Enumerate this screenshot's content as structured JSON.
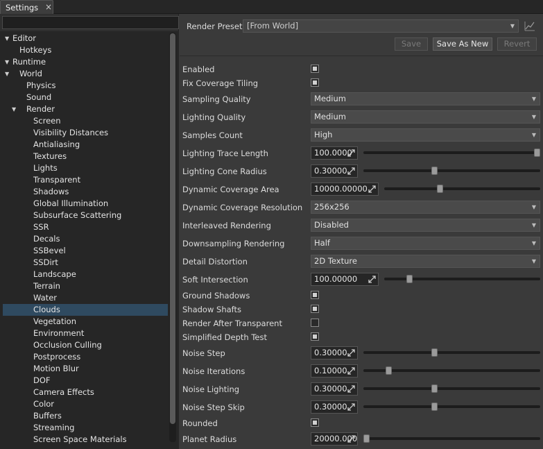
{
  "tab": {
    "label": "Settings",
    "close": "×"
  },
  "search": {
    "value": "",
    "placeholder": ""
  },
  "tree": [
    {
      "label": "Editor",
      "depth": 0,
      "expanded": true
    },
    {
      "label": "Hotkeys",
      "depth": 1
    },
    {
      "label": "Runtime",
      "depth": 0,
      "expanded": true
    },
    {
      "label": "World",
      "depth": 1,
      "expanded": true
    },
    {
      "label": "Physics",
      "depth": 2
    },
    {
      "label": "Sound",
      "depth": 2
    },
    {
      "label": "Render",
      "depth": 2,
      "expanded": true
    },
    {
      "label": "Screen",
      "depth": 3
    },
    {
      "label": "Visibility Distances",
      "depth": 3
    },
    {
      "label": "Antialiasing",
      "depth": 3
    },
    {
      "label": "Textures",
      "depth": 3
    },
    {
      "label": "Lights",
      "depth": 3
    },
    {
      "label": "Transparent",
      "depth": 3
    },
    {
      "label": "Shadows",
      "depth": 3
    },
    {
      "label": "Global Illumination",
      "depth": 3
    },
    {
      "label": "Subsurface Scattering",
      "depth": 3
    },
    {
      "label": "SSR",
      "depth": 3
    },
    {
      "label": "Decals",
      "depth": 3
    },
    {
      "label": "SSBevel",
      "depth": 3
    },
    {
      "label": "SSDirt",
      "depth": 3
    },
    {
      "label": "Landscape",
      "depth": 3
    },
    {
      "label": "Terrain",
      "depth": 3
    },
    {
      "label": "Water",
      "depth": 3
    },
    {
      "label": "Clouds",
      "depth": 3,
      "selected": true
    },
    {
      "label": "Vegetation",
      "depth": 3
    },
    {
      "label": "Environment",
      "depth": 3
    },
    {
      "label": "Occlusion Culling",
      "depth": 3
    },
    {
      "label": "Postprocess",
      "depth": 3
    },
    {
      "label": "Motion Blur",
      "depth": 3
    },
    {
      "label": "DOF",
      "depth": 3
    },
    {
      "label": "Camera Effects",
      "depth": 3
    },
    {
      "label": "Color",
      "depth": 3
    },
    {
      "label": "Buffers",
      "depth": 3
    },
    {
      "label": "Streaming",
      "depth": 3
    },
    {
      "label": "Screen Space Materials",
      "depth": 3
    }
  ],
  "preset": {
    "label": "Render Preset:",
    "value": "[From World]",
    "save": "Save",
    "save_as_new": "Save As New",
    "revert": "Revert"
  },
  "properties": [
    {
      "label": "Enabled",
      "type": "checkbox",
      "checked": true
    },
    {
      "label": "Fix Coverage Tiling",
      "type": "checkbox",
      "checked": true
    },
    {
      "label": "Sampling Quality",
      "type": "dropdown",
      "value": "Medium"
    },
    {
      "label": "Lighting Quality",
      "type": "dropdown",
      "value": "Medium"
    },
    {
      "label": "Samples Count",
      "type": "dropdown",
      "value": "High"
    },
    {
      "label": "Lighting Trace Length",
      "type": "slider",
      "value": "100.0000",
      "level": 1.0,
      "wide": false
    },
    {
      "label": "Lighting Cone Radius",
      "type": "slider",
      "value": "0.30000",
      "level": 0.4,
      "wide": false
    },
    {
      "label": "Dynamic Coverage Area",
      "type": "slider",
      "value": "10000.00000",
      "level": 0.35,
      "wide": true
    },
    {
      "label": "Dynamic Coverage Resolution",
      "type": "dropdown",
      "value": "256x256"
    },
    {
      "label": "Interleaved Rendering",
      "type": "dropdown",
      "value": "Disabled"
    },
    {
      "label": "Downsampling Rendering",
      "type": "dropdown",
      "value": "Half"
    },
    {
      "label": "Detail Distortion",
      "type": "dropdown",
      "value": "2D Texture"
    },
    {
      "label": "Soft Intersection",
      "type": "slider",
      "value": "100.00000",
      "level": 0.15,
      "wide": true
    },
    {
      "label": "Ground Shadows",
      "type": "checkbox",
      "checked": true
    },
    {
      "label": "Shadow Shafts",
      "type": "checkbox",
      "checked": true
    },
    {
      "label": "Render After Transparent",
      "type": "checkbox",
      "checked": false
    },
    {
      "label": "Simplified Depth Test",
      "type": "checkbox",
      "checked": true
    },
    {
      "label": "Noise Step",
      "type": "slider",
      "value": "0.30000",
      "level": 0.4,
      "wide": false
    },
    {
      "label": "Noise Iterations",
      "type": "slider",
      "value": "0.10000",
      "level": 0.13,
      "wide": false
    },
    {
      "label": "Noise Lighting",
      "type": "slider",
      "value": "0.30000",
      "level": 0.4,
      "wide": false
    },
    {
      "label": "Noise Step Skip",
      "type": "slider",
      "value": "0.30000",
      "level": 0.4,
      "wide": false
    },
    {
      "label": "Rounded",
      "type": "checkbox",
      "checked": true
    },
    {
      "label": "Planet Radius",
      "type": "slider",
      "value": "20000.0000",
      "level": 0.0,
      "wide": false
    }
  ]
}
